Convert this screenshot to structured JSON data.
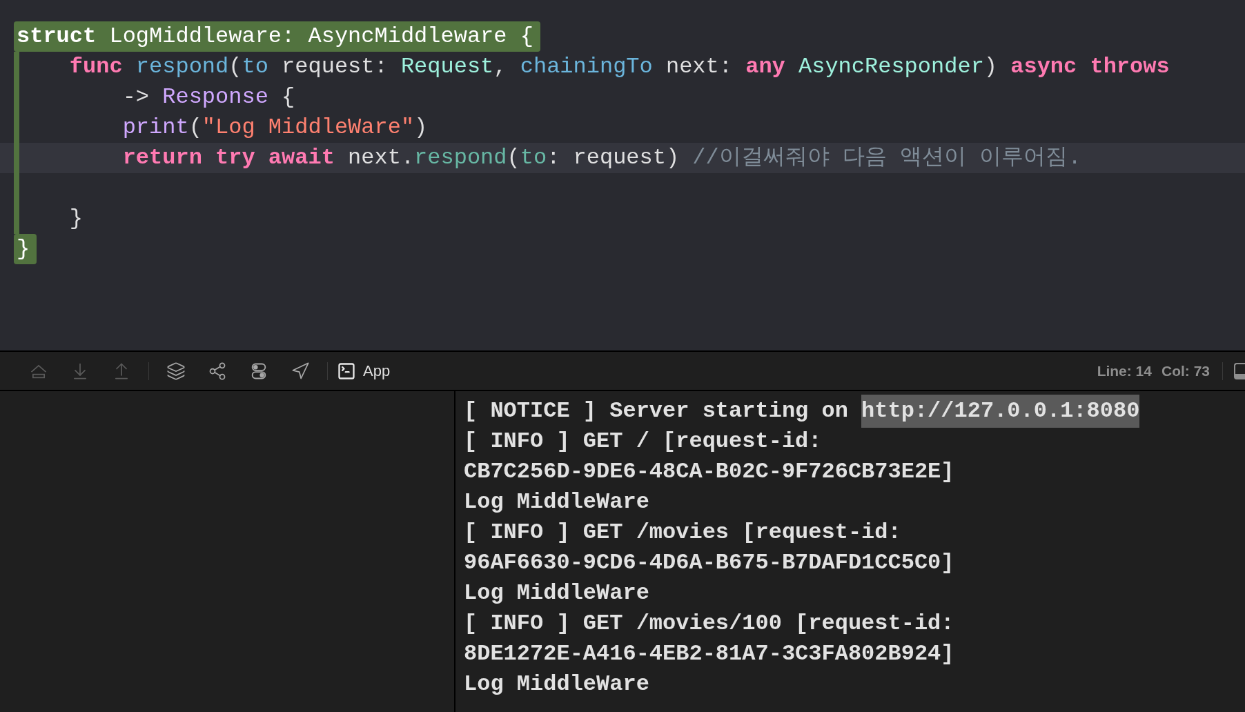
{
  "editor": {
    "lines": [
      {
        "kind": "scope_open",
        "current": false,
        "tokens": [
          {
            "text": "struct",
            "kind": "keyword"
          },
          {
            "text": " LogMiddleware: AsyncMiddleware {",
            "kind": "plain"
          }
        ]
      },
      {
        "kind": "code",
        "current": false,
        "tokens": [
          {
            "text": "    func",
            "kind": "keyword"
          },
          {
            "text": " respond",
            "kind": "decl"
          },
          {
            "text": "(",
            "kind": "plain"
          },
          {
            "text": "to",
            "kind": "decl"
          },
          {
            "text": " request: ",
            "kind": "plain"
          },
          {
            "text": "Request",
            "kind": "type"
          },
          {
            "text": ", ",
            "kind": "plain"
          },
          {
            "text": "chainingTo",
            "kind": "decl"
          },
          {
            "text": " next: ",
            "kind": "plain"
          },
          {
            "text": "any",
            "kind": "keyword"
          },
          {
            "text": " AsyncResponder",
            "kind": "type"
          },
          {
            "text": ") ",
            "kind": "plain"
          },
          {
            "text": "async",
            "kind": "keyword"
          },
          {
            "text": " throws",
            "kind": "keyword"
          }
        ]
      },
      {
        "kind": "code",
        "current": false,
        "tokens": [
          {
            "text": "        -> ",
            "kind": "plain"
          },
          {
            "text": "Response",
            "kind": "systype"
          },
          {
            "text": " {",
            "kind": "plain"
          }
        ]
      },
      {
        "kind": "code",
        "current": false,
        "tokens": [
          {
            "text": "        print",
            "kind": "systype"
          },
          {
            "text": "(",
            "kind": "plain"
          },
          {
            "text": "\"Log MiddleWare\"",
            "kind": "string"
          },
          {
            "text": ")",
            "kind": "plain"
          }
        ]
      },
      {
        "kind": "code",
        "current": true,
        "tokens": [
          {
            "text": "        return",
            "kind": "keyword"
          },
          {
            "text": " try",
            "kind": "keyword"
          },
          {
            "text": " await",
            "kind": "keyword"
          },
          {
            "text": " next.",
            "kind": "plain"
          },
          {
            "text": "respond",
            "kind": "call"
          },
          {
            "text": "(",
            "kind": "plain"
          },
          {
            "text": "to",
            "kind": "call"
          },
          {
            "text": ": request) ",
            "kind": "plain"
          },
          {
            "text": "//이걸써줘야 다음 액션이 이루어짐.",
            "kind": "comment"
          }
        ]
      },
      {
        "kind": "blank",
        "current": false
      },
      {
        "kind": "code",
        "current": false,
        "tokens": [
          {
            "text": "    }",
            "kind": "plain"
          }
        ]
      },
      {
        "kind": "scope_close",
        "current": false,
        "tokens": [
          {
            "text": "}",
            "kind": "plain"
          }
        ]
      }
    ]
  },
  "toolbar": {
    "buttons": [
      {
        "kind": "hide",
        "disabled": true
      },
      {
        "kind": "download",
        "disabled": true
      },
      {
        "kind": "upload",
        "disabled": true
      },
      {
        "kind": "layers",
        "disabled": false
      },
      {
        "kind": "nodes",
        "disabled": false
      },
      {
        "kind": "toggles",
        "disabled": false
      },
      {
        "kind": "location",
        "disabled": false
      }
    ],
    "scheme": "App",
    "line": "Line: 14",
    "col": "Col: 73"
  },
  "console": {
    "lines": [
      {
        "segments": [
          {
            "text": "[ NOTICE ] Server starting on ",
            "selected": false
          },
          {
            "text": "http://127.0.0.1:8080",
            "selected": true
          }
        ]
      },
      {
        "segments": [
          {
            "text": "[ INFO ] GET / [request-id:",
            "selected": false
          }
        ]
      },
      {
        "segments": [
          {
            "text": "CB7C256D-9DE6-48CA-B02C-9F726CB73E2E]",
            "selected": false
          }
        ]
      },
      {
        "segments": [
          {
            "text": "Log MiddleWare",
            "selected": false
          }
        ]
      },
      {
        "segments": [
          {
            "text": "[ INFO ] GET /movies [request-id:",
            "selected": false
          }
        ]
      },
      {
        "segments": [
          {
            "text": "96AF6630-9CD6-4D6A-B675-B7DAFD1CC5C0]",
            "selected": false
          }
        ]
      },
      {
        "segments": [
          {
            "text": "Log MiddleWare",
            "selected": false
          }
        ]
      },
      {
        "segments": [
          {
            "text": "[ INFO ] GET /movies/100 [request-id:",
            "selected": false
          }
        ]
      },
      {
        "segments": [
          {
            "text": "8DE1272E-A416-4EB2-81A7-3C3FA802B924]",
            "selected": false
          }
        ]
      },
      {
        "segments": [
          {
            "text": "Log MiddleWare",
            "selected": false
          }
        ]
      }
    ]
  }
}
